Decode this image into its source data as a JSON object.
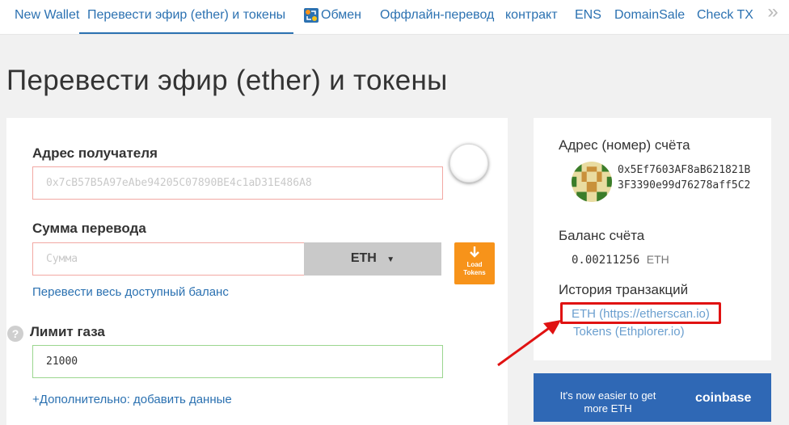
{
  "nav": {
    "items": [
      "New Wallet",
      "Перевести эфир (ether) и токены",
      "Обмен",
      "Оффлайн-перевод",
      "контракт",
      "ENS",
      "DomainSale",
      "Check TX"
    ],
    "more": "»"
  },
  "page_title": "Перевести эфир (ether) и токены",
  "form": {
    "recipient_label": "Адрес получателя",
    "recipient_placeholder": "0x7cB57B5A97eAbe94205C07890BE4c1aD31E486A8",
    "amount_label": "Сумма перевода",
    "amount_placeholder": "Сумма",
    "unit": "ETH",
    "load_tokens_line1": "Load",
    "load_tokens_line2": "Tokens",
    "send_all_link": "Перевести весь доступный баланс",
    "gas_help": "?",
    "gas_label": "Лимит газа",
    "gas_value": "21000",
    "advanced_link": "+Дополнительно: добавить данные"
  },
  "account": {
    "address_label": "Адрес (номер) счёта",
    "address": "0x5Ef7603AF8aB621821B3F3390e99d76278aff5C2",
    "balance_label": "Баланс счёта",
    "balance_value": "0.00211256",
    "balance_unit": "ETH",
    "history_label": "История транзакций",
    "history_eth": "ETH (https://etherscan.io)",
    "history_tokens": "Tokens (Ethplorer.io)"
  },
  "banner": {
    "text": "It's now easier to get more ETH",
    "brand": "coinbase"
  },
  "colors": {
    "link": "#2b71b1",
    "error_border": "#f2a8a3",
    "ok_border": "#9bd68f",
    "load_tokens_bg": "#f7931a",
    "highlight": "#e01212",
    "banner_bg": "#2f68b5"
  }
}
